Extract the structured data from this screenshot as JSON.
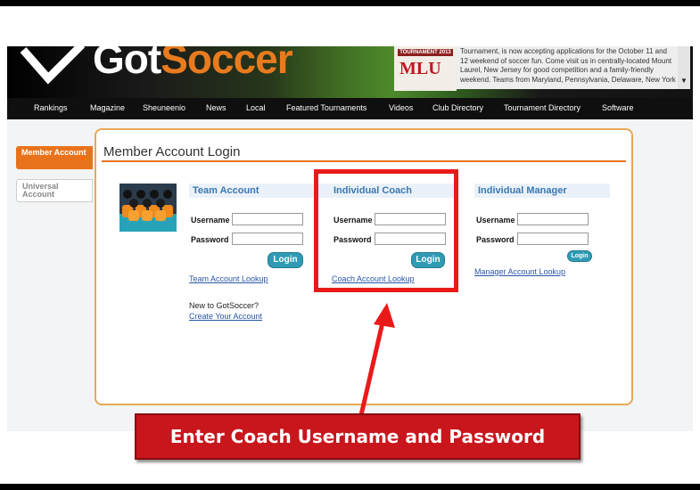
{
  "site": {
    "logo_part1": "Got",
    "logo_part2": "Soccer",
    "ad_badge": "TOURNAMENT 2013",
    "ad_logo": "MLU",
    "ad_text": "Tournament, is now accepting applications for the October 11 and 12 weekend of soccer fun. Come visit us in centrally-located Mount Laurel, New Jersey for good competition and a family-friendly weekend. Teams from Maryland, Pennsylvania, Delaware, New York"
  },
  "nav": {
    "items": [
      "Rankings",
      "Magazine",
      "Sheuneenio",
      "News",
      "Local",
      "Featured Tournaments",
      "Videos",
      "Club Directory",
      "Tournament Directory",
      "Software"
    ]
  },
  "sidebar": {
    "items": [
      {
        "label": "Member Account"
      },
      {
        "label": "Universal Account"
      }
    ]
  },
  "panel": {
    "title": "Member Account Login"
  },
  "team": {
    "heading": "Team Account",
    "username_label": "Username",
    "password_label": "Password",
    "login_label": "Login",
    "lookup_link": "Team Account Lookup",
    "new_text": "New to GotSoccer?",
    "create_link": "Create Your Account"
  },
  "coach": {
    "heading": "Individual Coach",
    "username_label": "Username",
    "password_label": "Password",
    "login_label": "Login",
    "lookup_link": "Coach Account Lookup"
  },
  "manager": {
    "heading": "Individual Manager",
    "username_label": "Username",
    "password_label": "Password",
    "login_label": "Login",
    "lookup_link": "Manager Account Lookup"
  },
  "annotation": {
    "callout": "Enter Coach Username and Password",
    "color": "#ea1a1a"
  },
  "colors": {
    "accent": "#e8731c",
    "link": "#2a56a8",
    "button": "#2f9bb5"
  }
}
